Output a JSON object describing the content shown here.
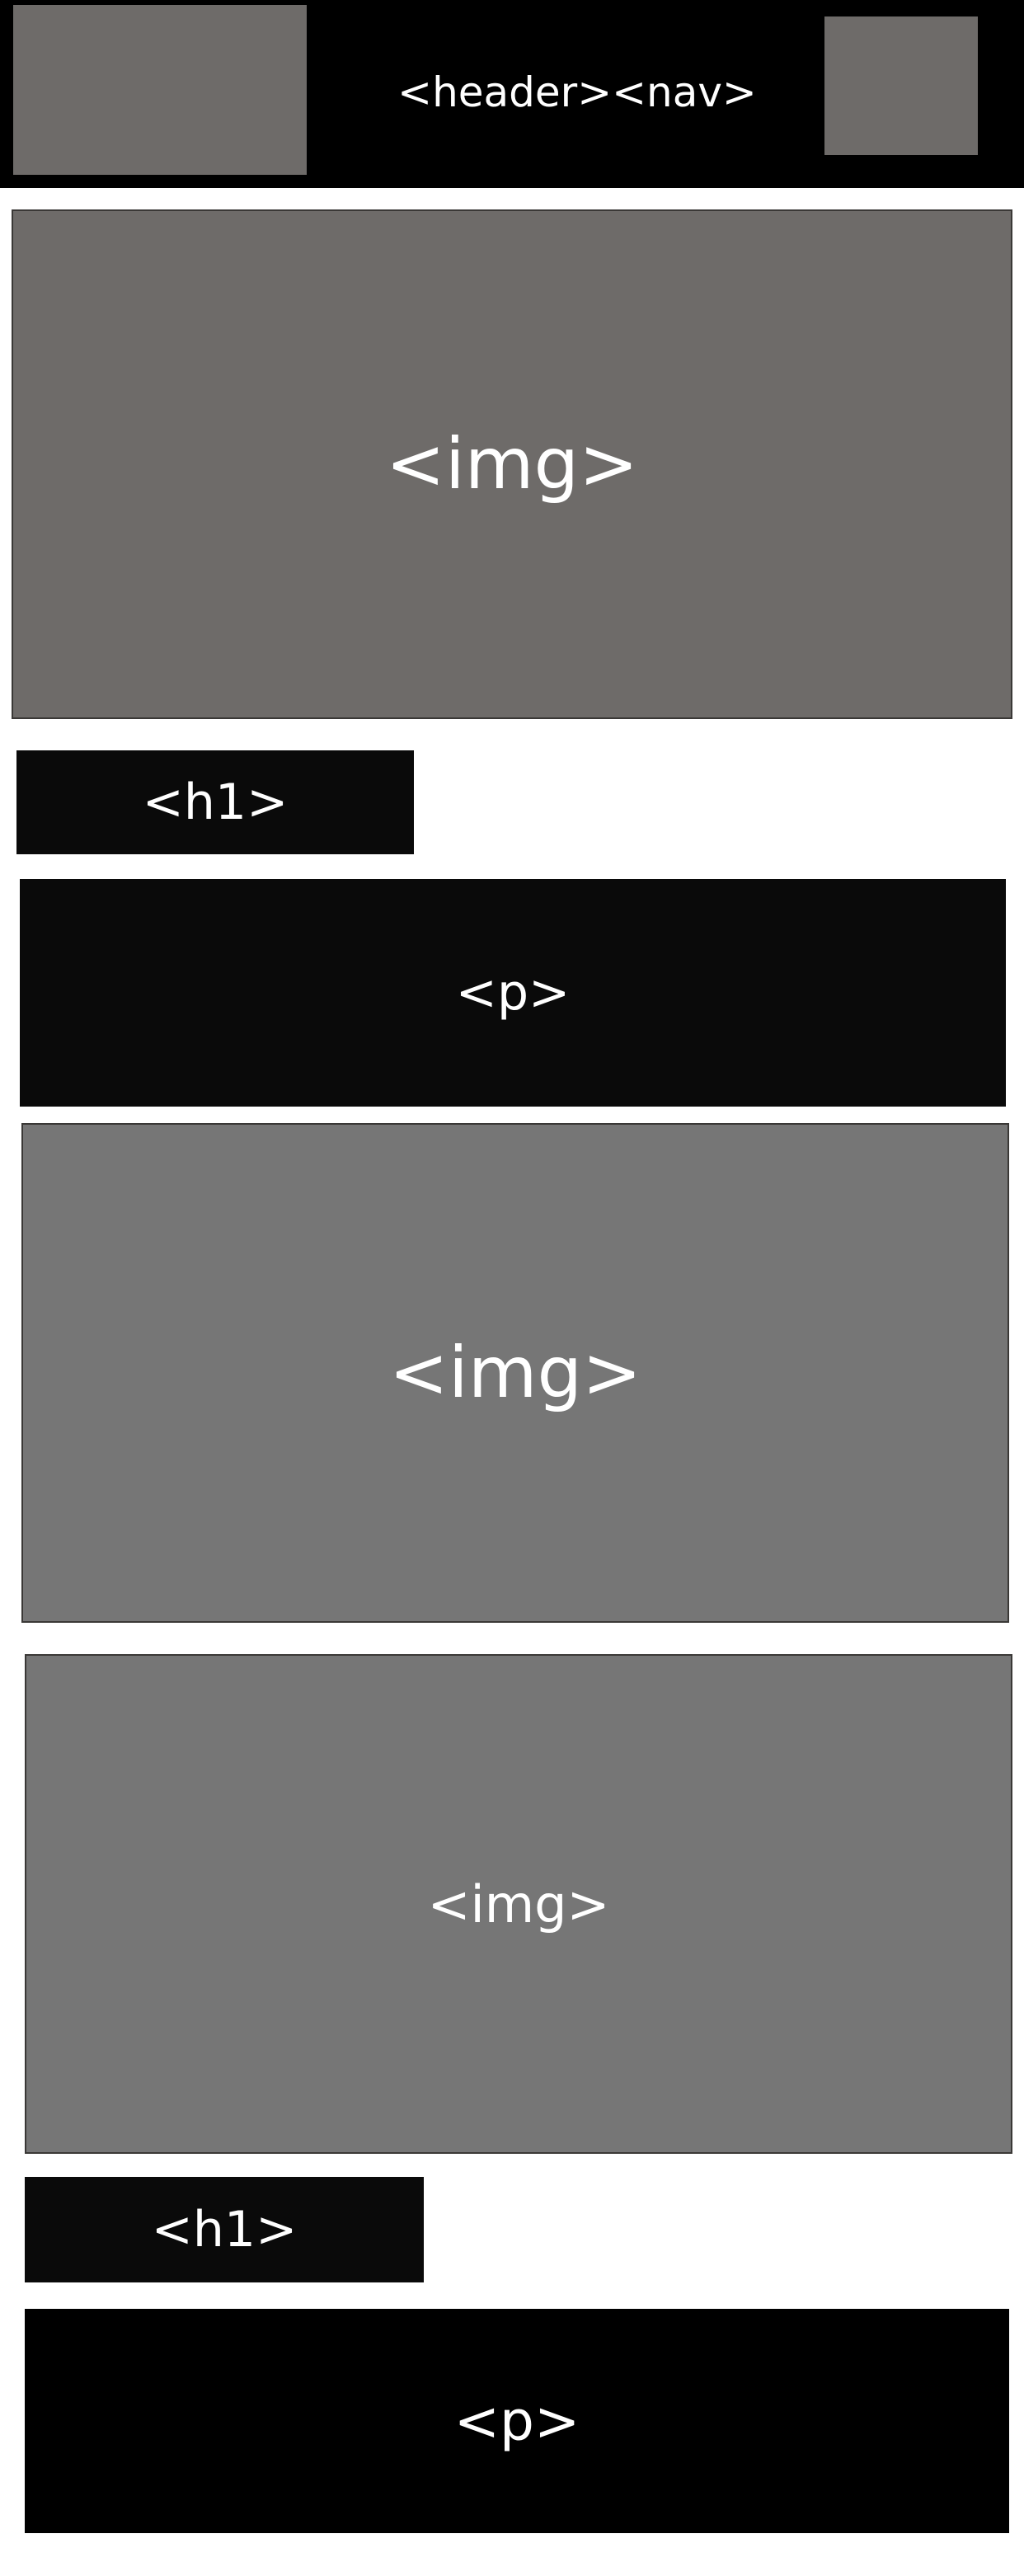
{
  "header": {
    "label": "<header><nav>"
  },
  "sections": {
    "img_1": "<img>",
    "h1_1": "<h1>",
    "p_1": "<p>",
    "img_2": "<img>",
    "img_3": "<img>",
    "h1_2": "<h1>",
    "p_2": "<p>"
  },
  "colors": {
    "header_background": "#000000",
    "placeholder_gray_dark": "#6e6b69",
    "placeholder_gray": "#767676",
    "text_block_background": "#0a0a0a",
    "label_text": "#ffffff"
  }
}
